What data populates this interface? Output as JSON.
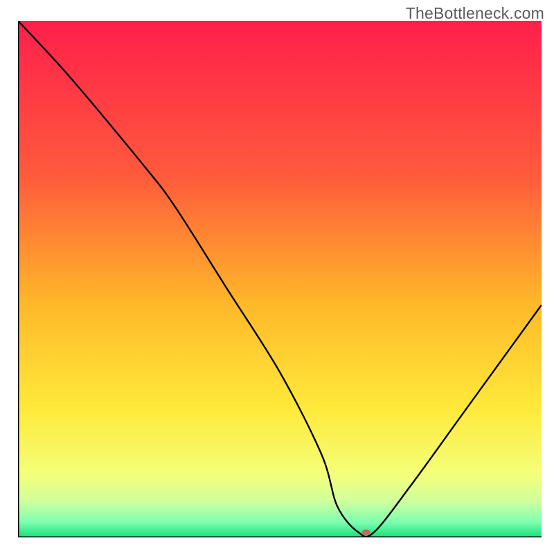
{
  "watermark": {
    "text": "TheBottleneck.com"
  },
  "chart_data": {
    "type": "line",
    "title": "",
    "xlabel": "",
    "ylabel": "",
    "xlim": [
      0,
      100
    ],
    "ylim": [
      0,
      100
    ],
    "series": [
      {
        "name": "curve",
        "x": [
          0,
          10,
          24,
          30,
          40,
          50,
          58,
          61,
          65,
          68,
          75,
          85,
          95,
          100
        ],
        "values": [
          100,
          89,
          72,
          64,
          48,
          32,
          16,
          6,
          1,
          1,
          10,
          24,
          38,
          45
        ]
      }
    ],
    "marker": {
      "x": 66.5,
      "y": 1,
      "color": "#d1605e",
      "rx": 6,
      "ry": 4
    },
    "background_gradient": {
      "stops": [
        {
          "offset": 0,
          "color": "#ff1f4b"
        },
        {
          "offset": 30,
          "color": "#ff5a3c"
        },
        {
          "offset": 55,
          "color": "#ffb929"
        },
        {
          "offset": 75,
          "color": "#ffe93a"
        },
        {
          "offset": 88,
          "color": "#f3ff7a"
        },
        {
          "offset": 93,
          "color": "#cfff9e"
        },
        {
          "offset": 97,
          "color": "#7fffb0"
        },
        {
          "offset": 100,
          "color": "#17e07a"
        }
      ]
    },
    "axes_color": "#000000"
  }
}
